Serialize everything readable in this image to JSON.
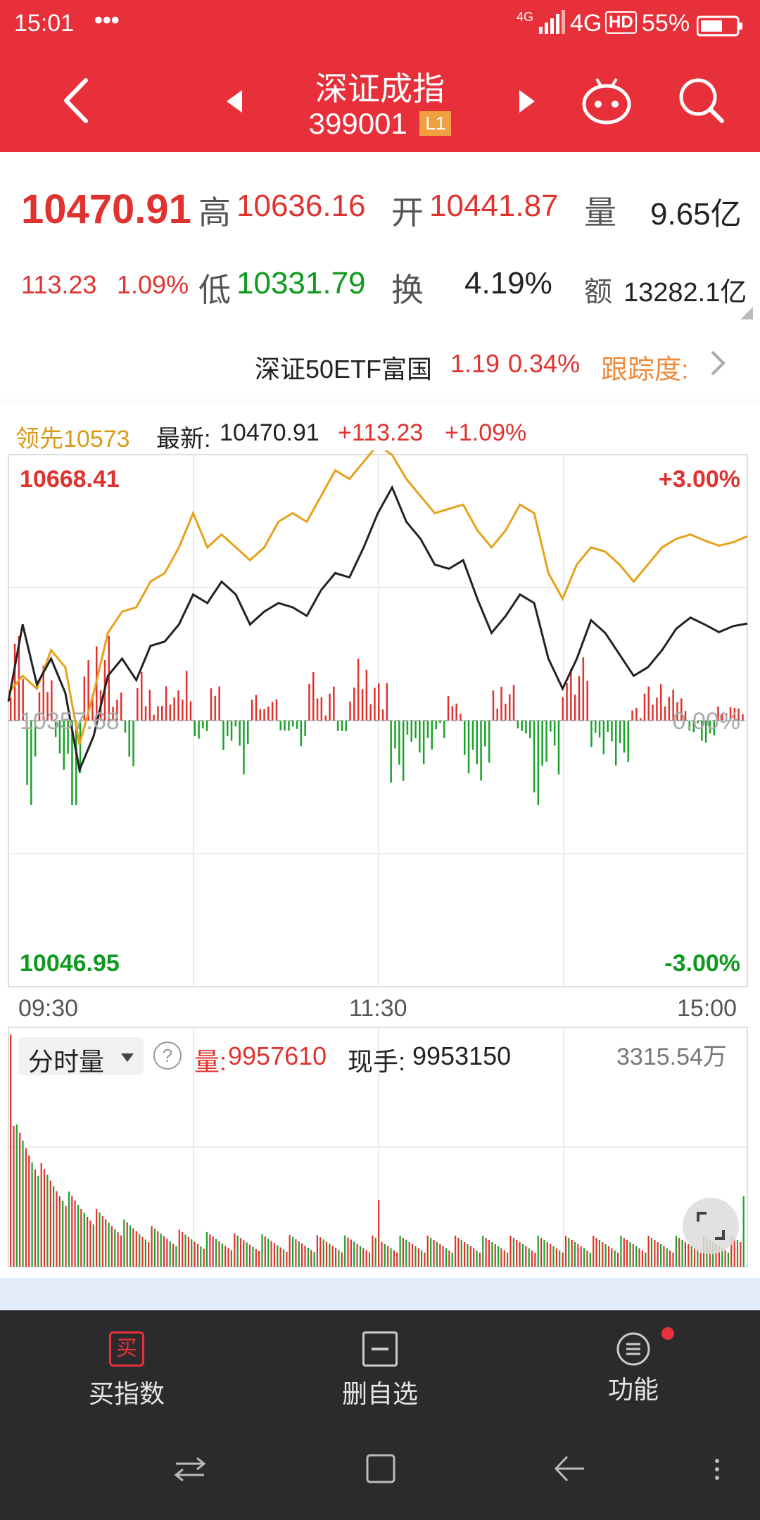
{
  "status": {
    "time": "15:01",
    "dots": "•••",
    "net": "4G",
    "net_small": "4G",
    "hd": "HD",
    "battery": "55%"
  },
  "header": {
    "title": "深证成指",
    "code": "399001",
    "badge": "L1"
  },
  "quote": {
    "price": "10470.91",
    "change": "113.23",
    "change_pct": "1.09%",
    "high_label": "高",
    "high": "10636.16",
    "open_label": "开",
    "open": "10441.87",
    "vol_label": "量",
    "vol": "9.65亿",
    "low_label": "低",
    "low": "10331.79",
    "turnover_label": "换",
    "turnover": "4.19%",
    "amount_label": "额",
    "amount": "13282.1亿"
  },
  "etf": {
    "name": "深证50ETF富国",
    "price": "1.19",
    "pct": "0.34%",
    "track_label": "跟踪度:"
  },
  "legend": {
    "lead": "领先10573",
    "latest_label": "最新:",
    "latest": "10470.91",
    "change": "+113.23",
    "pct": "+1.09%"
  },
  "axes": {
    "top": "10668.41",
    "top_pct": "+3.00%",
    "mid": "10357.68",
    "mid_pct": "0.00%",
    "bottom": "10046.95",
    "bottom_pct": "-3.00%",
    "t1": "09:30",
    "t2": "11:30",
    "t3": "15:00"
  },
  "volume_panel": {
    "selector": "分时量",
    "help": "?",
    "vol_label": "量:",
    "vol": "9957610",
    "hand_label": "现手:",
    "hand": "9953150",
    "max": "3315.54万"
  },
  "bottom_nav": {
    "buy": "买指数",
    "buy_icon": "买",
    "remove": "删自选",
    "func": "功能"
  },
  "colors": {
    "red": "#e8303a",
    "up": "#e0322f",
    "down": "#0f9a1f",
    "lead": "#e6a21a"
  },
  "chart_data": {
    "type": "line",
    "title": "",
    "x_ticks": [
      "09:30",
      "11:30",
      "15:00"
    ],
    "ylim": [
      10046.95,
      10668.41
    ],
    "prev_close": 10357.68,
    "series": [
      {
        "name": "最新",
        "values": [
          10380,
          10470,
          10400,
          10430,
          10390,
          10300,
          10340,
          10410,
          10430,
          10405,
          10445,
          10450,
          10470,
          10505,
          10495,
          10520,
          10505,
          10470,
          10485,
          10495,
          10490,
          10480,
          10510,
          10530,
          10525,
          10560,
          10600,
          10630,
          10590,
          10570,
          10540,
          10535,
          10545,
          10500,
          10460,
          10480,
          10505,
          10495,
          10430,
          10395,
          10430,
          10475,
          10460,
          10435,
          10410,
          10420,
          10440,
          10465,
          10478,
          10470,
          10461,
          10468,
          10471
        ]
      },
      {
        "name": "领先",
        "values": [
          10390,
          10410,
          10395,
          10440,
          10420,
          10330,
          10390,
          10460,
          10485,
          10490,
          10520,
          10530,
          10560,
          10600,
          10560,
          10575,
          10560,
          10545,
          10560,
          10590,
          10600,
          10590,
          10620,
          10650,
          10640,
          10660,
          10680,
          10668,
          10640,
          10620,
          10600,
          10605,
          10610,
          10580,
          10560,
          10580,
          10610,
          10600,
          10530,
          10500,
          10540,
          10560,
          10555,
          10540,
          10520,
          10540,
          10560,
          10570,
          10575,
          10568,
          10562,
          10566,
          10573
        ]
      }
    ]
  }
}
